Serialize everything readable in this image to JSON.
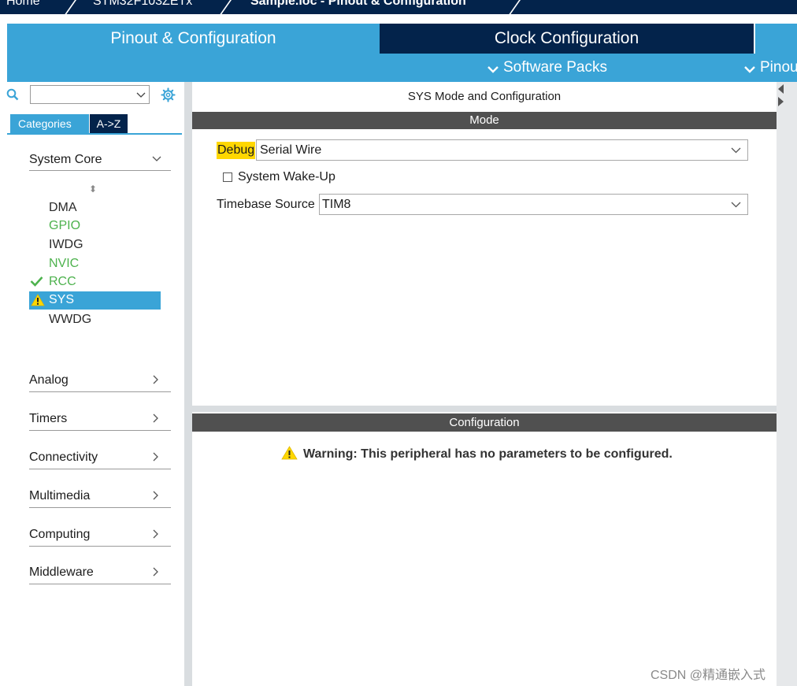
{
  "breadcrumb": {
    "home": "Home",
    "device": "STM32F103ZETx",
    "current": "Sample.ioc - Pinout & Configuration"
  },
  "tabs": {
    "pinout": "Pinout & Configuration",
    "clock": "Clock Configuration"
  },
  "menus": {
    "software_packs": "Software Packs",
    "pinout": "Pinout"
  },
  "sidebar": {
    "search_value": "",
    "tab_categories": "Categories",
    "tab_az": "A->Z",
    "system_core": "System Core",
    "peripherals": [
      {
        "label": "DMA",
        "status": "none"
      },
      {
        "label": "GPIO",
        "status": "configured"
      },
      {
        "label": "IWDG",
        "status": "none"
      },
      {
        "label": "NVIC",
        "status": "configured"
      },
      {
        "label": "RCC",
        "status": "ok"
      },
      {
        "label": "SYS",
        "status": "warning"
      },
      {
        "label": "WWDG",
        "status": "none"
      }
    ],
    "categories": [
      "Analog",
      "Timers",
      "Connectivity",
      "Multimedia",
      "Computing",
      "Middleware"
    ]
  },
  "mode_panel": {
    "title": "SYS Mode and Configuration",
    "section_mode": "Mode",
    "debug_label": "Debug",
    "debug_value": "Serial Wire",
    "wakeup_label": "System Wake-Up",
    "wakeup_checked": false,
    "timebase_label": "Timebase Source",
    "timebase_value": "TIM8"
  },
  "config_panel": {
    "section_title": "Configuration",
    "warning": "Warning: This peripheral has no parameters to be configured."
  },
  "watermark": "CSDN @精通嵌入式",
  "colors": {
    "accent": "#3aa4d7",
    "navy": "#03234b",
    "green": "#4db24d",
    "highlight": "#ffd700",
    "bar": "#505050"
  }
}
